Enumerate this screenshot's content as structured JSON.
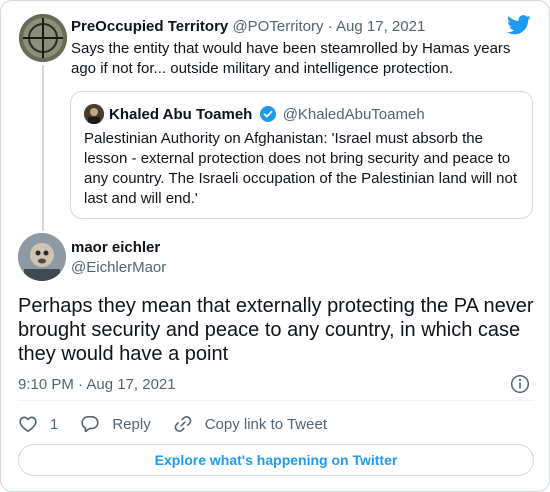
{
  "parent_tweet": {
    "author_name": "PreOccupied Territory",
    "author_handle": "@POTerritory",
    "separator": "·",
    "date": "Aug 17, 2021",
    "text": "Says the entity that would have been steamrolled by Hamas years ago if not for... outside military and intelligence protection."
  },
  "quoted_tweet": {
    "author_name": "Khaled Abu Toameh",
    "author_handle": "@KhaledAbuToameh",
    "text": "Palestinian Authority on Afghanistan: 'Israel must absorb the lesson - external protection does not bring security and peace to any country. The Israeli occupation of the Palestinian land will not last and will end.'"
  },
  "main_tweet": {
    "author_name": "maor eichler",
    "author_handle": "@EichlerMaor",
    "text": "Perhaps they mean that externally protecting the PA never brought security and peace to any country, in which case they would have a point",
    "timestamp": "9:10 PM · Aug 17, 2021"
  },
  "actions": {
    "like_count": "1",
    "reply_label": "Reply",
    "copy_link_label": "Copy link to Tweet"
  },
  "explore_label": "Explore what's happening on Twitter",
  "colors": {
    "accent": "#1d9bf0",
    "secondary_text": "#536471",
    "border": "#cfd9de"
  },
  "icons": [
    "twitter-bird-icon",
    "verified-badge-icon",
    "info-icon",
    "heart-icon",
    "reply-icon",
    "link-icon"
  ]
}
